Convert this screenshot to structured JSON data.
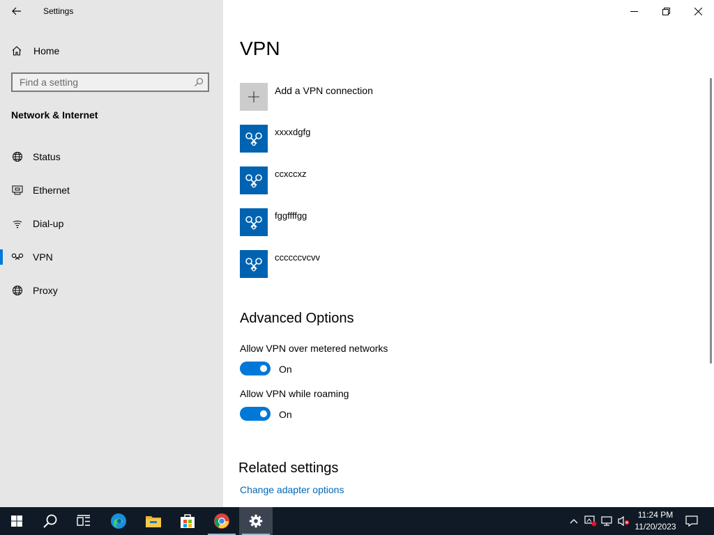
{
  "window": {
    "title": "Settings",
    "controls": [
      "minimize-icon",
      "restore-icon",
      "close-icon"
    ]
  },
  "sidebar": {
    "home_label": "Home",
    "search_placeholder": "Find a setting",
    "section_title": "Network & Internet",
    "items": [
      {
        "label": "Status",
        "icon": "status-globe-icon",
        "selected": false
      },
      {
        "label": "Ethernet",
        "icon": "ethernet-icon",
        "selected": false
      },
      {
        "label": "Dial-up",
        "icon": "dialup-icon",
        "selected": false
      },
      {
        "label": "VPN",
        "icon": "vpn-icon",
        "selected": true
      },
      {
        "label": "Proxy",
        "icon": "proxy-globe-icon",
        "selected": false
      }
    ]
  },
  "main": {
    "title": "VPN",
    "add_label": "Add a VPN connection",
    "connections": [
      "xxxxdgfg",
      "ccxccxz",
      "fggffffgg",
      "ccccccvcvv"
    ],
    "advanced": {
      "title": "Advanced Options",
      "options": [
        {
          "label": "Allow VPN over metered networks",
          "state": "On",
          "on": true
        },
        {
          "label": "Allow VPN while roaming",
          "state": "On",
          "on": true
        }
      ]
    },
    "related": {
      "title": "Related settings",
      "link": "Change adapter options"
    }
  },
  "taskbar": {
    "apps": [
      "windows-start-icon",
      "search-icon",
      "task-view-icon",
      "edge-icon",
      "file-explorer-icon",
      "store-icon",
      "chrome-icon",
      "settings-icon"
    ],
    "active_app": "settings-icon",
    "time": "11:24 PM",
    "date": "11/20/2023"
  },
  "colors": {
    "accent": "#0078d7",
    "tile_blue": "#0063b1",
    "sidebar_bg": "#e6e6e6",
    "link": "#0067b8",
    "taskbar_bg": "#101a26"
  }
}
